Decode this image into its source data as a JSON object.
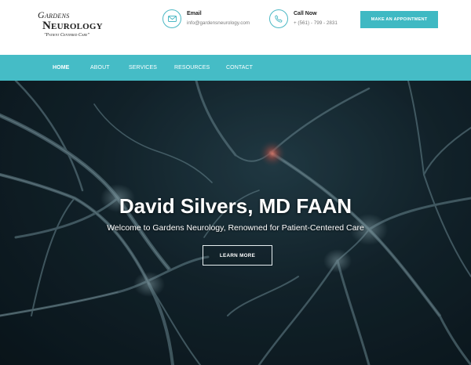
{
  "logo": {
    "line1": "Gardens",
    "line2": "Neurology",
    "tagline": "\"Patient Centered Care\""
  },
  "contact": {
    "email": {
      "label": "Email",
      "value": "info@gardensneurology.com",
      "icon": "mail-icon"
    },
    "phone": {
      "label": "Call Now",
      "value": "+ (561) - 799 - 2831",
      "icon": "phone-icon"
    }
  },
  "appointment_button": "MAKE AN APPOINTMENT",
  "nav": {
    "items": [
      {
        "label": "HOME",
        "active": true
      },
      {
        "label": "ABOUT",
        "active": false
      },
      {
        "label": "SERVICES",
        "active": false
      },
      {
        "label": "RESOURCES",
        "active": false
      },
      {
        "label": "CONTACT",
        "active": false
      }
    ]
  },
  "hero": {
    "title": "David Silvers, MD FAAN",
    "subtitle": "Welcome to Gardens Neurology, Renowned for Patient-Centered Care",
    "button": "LEARN MORE"
  },
  "colors": {
    "accent": "#45bcc6",
    "button": "#3fb9c3",
    "hero_dark": "#0a151b"
  }
}
